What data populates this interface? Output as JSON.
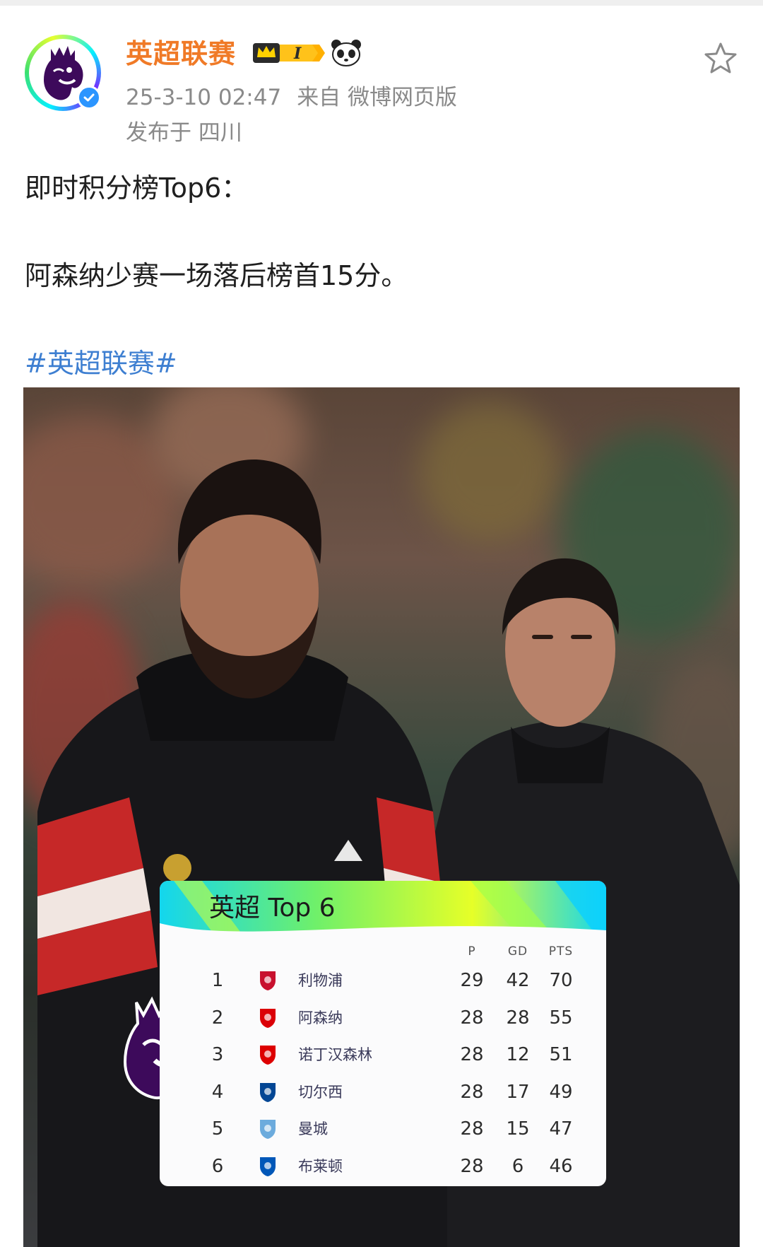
{
  "post": {
    "username": "英超联赛",
    "badge_level": "I",
    "timestamp": "25-3-10 02:47",
    "source": "来自 微博网页版",
    "location": "发布于 四川",
    "text_line1": "即时积分榜Top6：",
    "text_line2": "阿森纳少赛一场落后榜首15分。",
    "hashtag": "#英超联赛#",
    "icons": {
      "avatar": "premier-league-lion-icon",
      "verified": "verified-check-icon",
      "badge": "vip-crown-badge-icon",
      "panda": "panda-icon",
      "favorite": "star-outline-icon"
    },
    "colors": {
      "username": "#f07a27",
      "hashtag": "#3e7fd1",
      "meta": "#8a8a8a",
      "verified": "#2b95ff",
      "pl_purple": "#3d0a5b"
    }
  },
  "standings": {
    "title": "英超 Top 6",
    "headers": {
      "p": "P",
      "gd": "GD",
      "pts": "PTS"
    },
    "rows": [
      {
        "rank": "1",
        "team": "利物浦",
        "p": "29",
        "gd": "42",
        "pts": "70",
        "crest_color": "#c8102e",
        "crest": "liverpool-crest-icon"
      },
      {
        "rank": "2",
        "team": "阿森纳",
        "p": "28",
        "gd": "28",
        "pts": "55",
        "crest_color": "#db0007",
        "crest": "arsenal-crest-icon"
      },
      {
        "rank": "3",
        "team": "诺丁汉森林",
        "p": "28",
        "gd": "12",
        "pts": "51",
        "crest_color": "#dd0000",
        "crest": "nottingham-forest-crest-icon"
      },
      {
        "rank": "4",
        "team": "切尔西",
        "p": "28",
        "gd": "17",
        "pts": "49",
        "crest_color": "#034694",
        "crest": "chelsea-crest-icon"
      },
      {
        "rank": "5",
        "team": "曼城",
        "p": "28",
        "gd": "15",
        "pts": "47",
        "crest_color": "#6cabdd",
        "crest": "man-city-crest-icon"
      },
      {
        "rank": "6",
        "team": "布莱顿",
        "p": "28",
        "gd": "6",
        "pts": "46",
        "crest_color": "#0057b8",
        "crest": "brighton-crest-icon"
      }
    ]
  }
}
